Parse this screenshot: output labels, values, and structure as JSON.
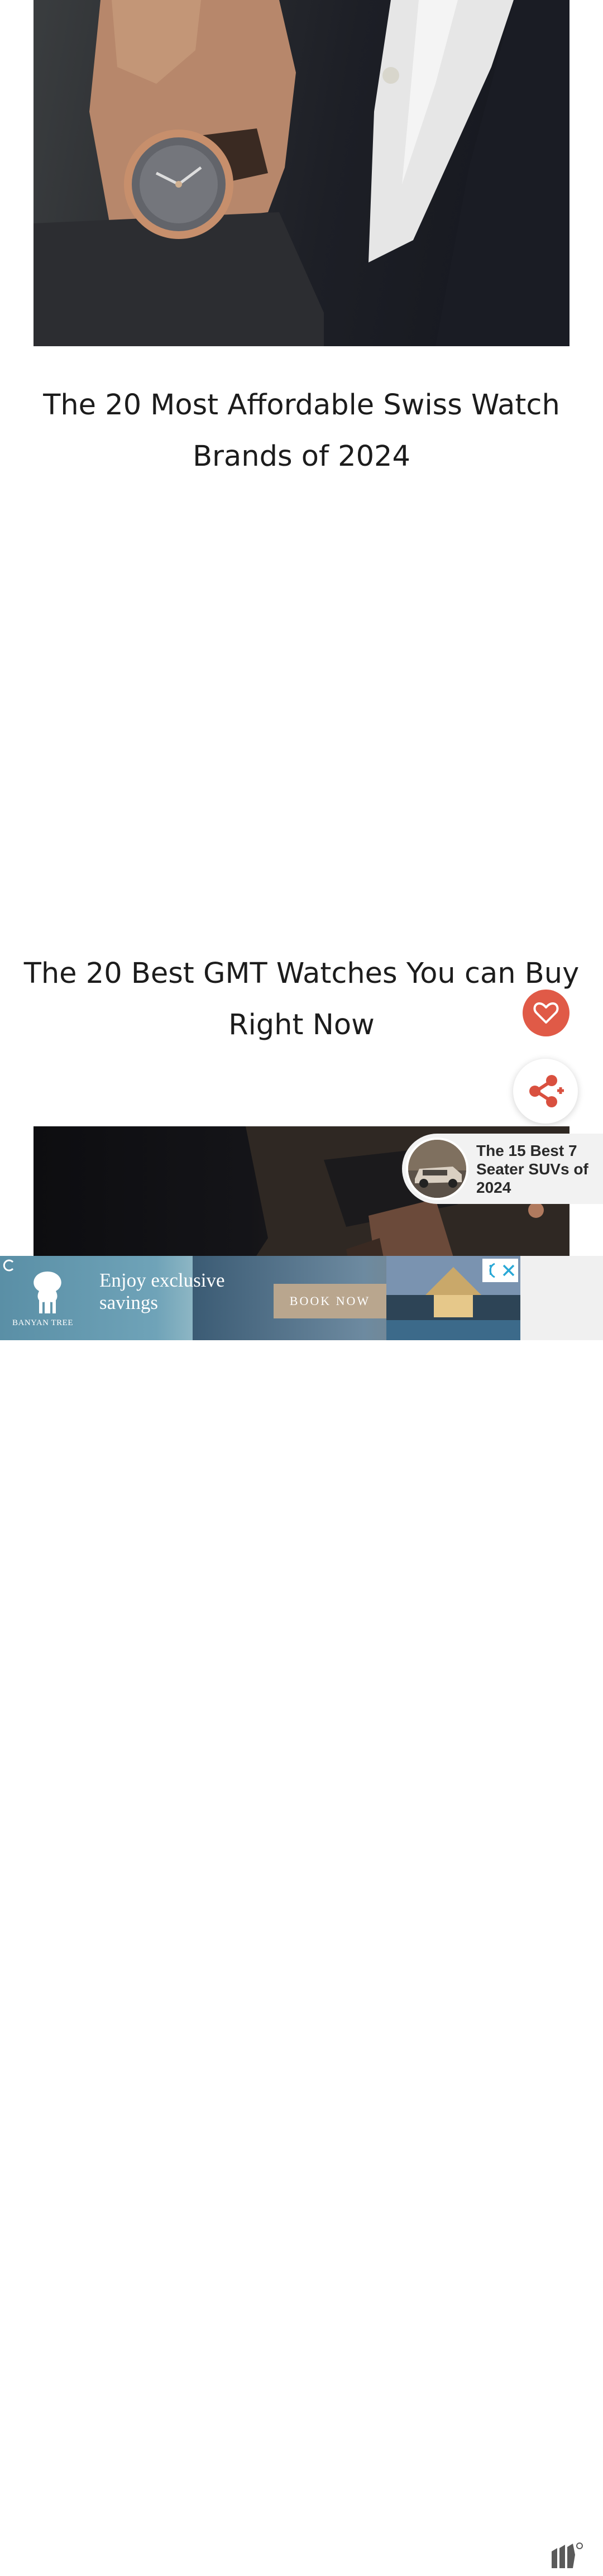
{
  "articles": [
    {
      "title": "The 20 Most Affordable Swiss Watch Brands of 2024"
    },
    {
      "title": "The 20 Best GMT Watches You can Buy Right Now"
    }
  ],
  "floating_actions": {
    "favorite_icon": "heart-icon",
    "share_icon": "share-icon"
  },
  "promo": {
    "title": "The 15 Best 7 Seater SUVs of 2024"
  },
  "ad": {
    "brand": "BANYAN TREE",
    "headline": "Enjoy exclusive savings",
    "cta": "BOOK NOW"
  },
  "colors": {
    "accent": "#e05a47",
    "title_text": "#1c1c1c"
  }
}
